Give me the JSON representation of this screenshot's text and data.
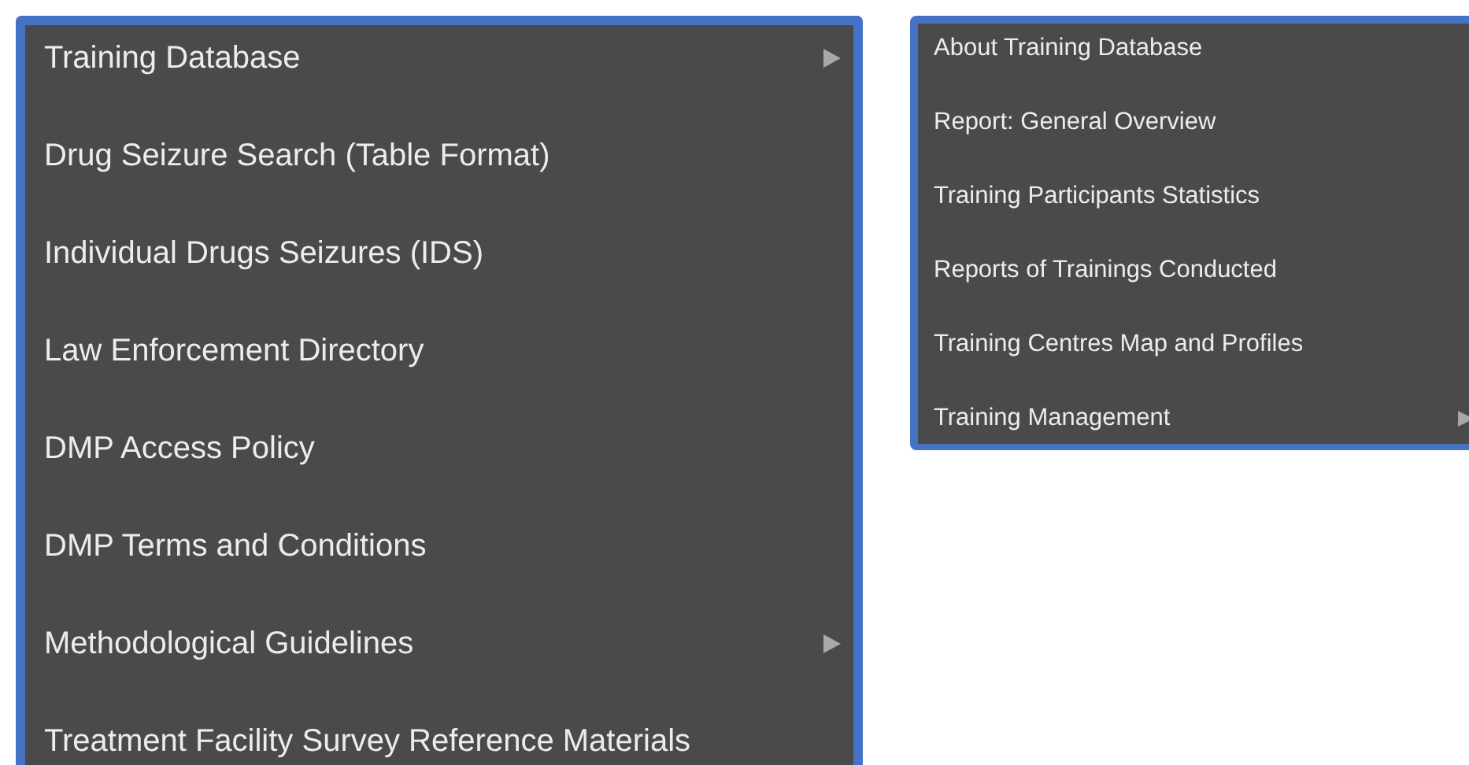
{
  "main_menu": {
    "items": [
      {
        "label": "Training Database",
        "has_submenu": true
      },
      {
        "label": "Drug Seizure Search (Table Format)",
        "has_submenu": false
      },
      {
        "label": "Individual Drugs Seizures (IDS)",
        "has_submenu": false
      },
      {
        "label": "Law Enforcement Directory",
        "has_submenu": false
      },
      {
        "label": "DMP Access Policy",
        "has_submenu": false
      },
      {
        "label": "DMP Terms and Conditions",
        "has_submenu": false
      },
      {
        "label": "Methodological Guidelines",
        "has_submenu": true
      },
      {
        "label": "Treatment Facility Survey Reference Materials",
        "has_submenu": false
      }
    ]
  },
  "submenu": {
    "items": [
      {
        "label": "About Training Database",
        "has_submenu": false
      },
      {
        "label": "Report: General Overview",
        "has_submenu": false
      },
      {
        "label": "Training Participants Statistics",
        "has_submenu": false
      },
      {
        "label": "Reports of Trainings Conducted",
        "has_submenu": false
      },
      {
        "label": "Training Centres Map and Profiles",
        "has_submenu": false
      },
      {
        "label": "Training Management",
        "has_submenu": true
      }
    ]
  }
}
